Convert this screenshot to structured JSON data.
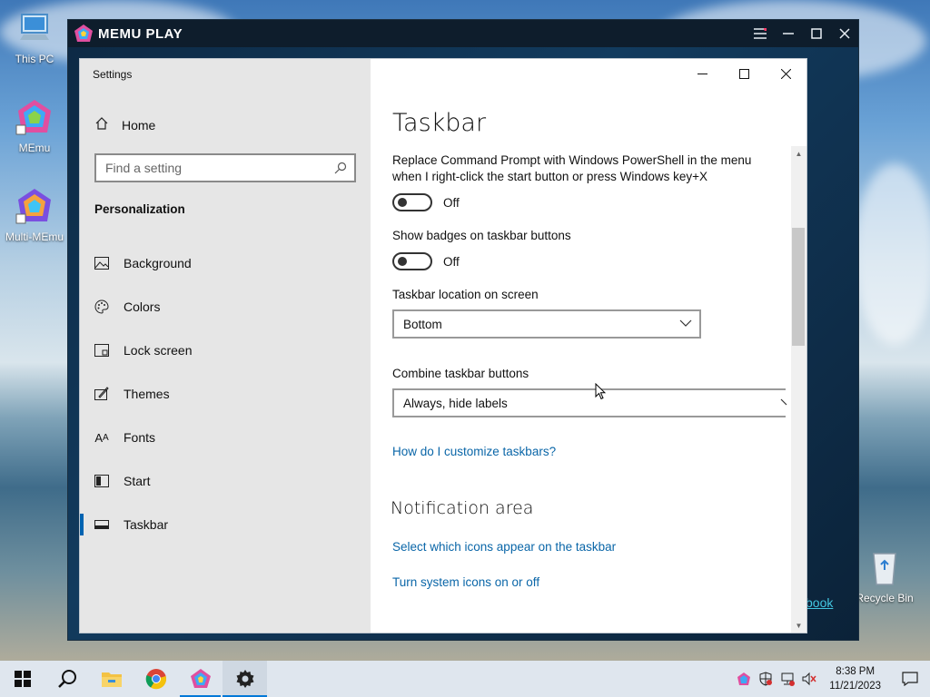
{
  "desktop": {
    "icons": [
      {
        "label": "This PC"
      },
      {
        "label": "MEmu"
      },
      {
        "label": "Multi-MEmu"
      },
      {
        "label": "Recycle Bin"
      }
    ],
    "partial_link_text": "book"
  },
  "memu": {
    "title": "MEMU PLAY",
    "controls": [
      "menu-icon",
      "minimize-icon",
      "maximize-icon",
      "close-icon"
    ]
  },
  "settings": {
    "window_title": "Settings",
    "home_label": "Home",
    "search_placeholder": "Find a setting",
    "section_heading": "Personalization",
    "nav": [
      {
        "label": "Background",
        "icon": "picture-icon"
      },
      {
        "label": "Colors",
        "icon": "palette-icon"
      },
      {
        "label": "Lock screen",
        "icon": "lock-screen-icon"
      },
      {
        "label": "Themes",
        "icon": "themes-icon"
      },
      {
        "label": "Fonts",
        "icon": "fonts-icon"
      },
      {
        "label": "Start",
        "icon": "start-icon"
      },
      {
        "label": "Taskbar",
        "icon": "taskbar-icon",
        "active": true
      }
    ],
    "page_title": "Taskbar",
    "powershell_text_line1": "Replace Command Prompt with Windows PowerShell in the menu",
    "powershell_text_line2": "when I right-click the start button or press Windows key+X",
    "powershell_state": "Off",
    "badges_label": "Show badges on taskbar buttons",
    "badges_state": "Off",
    "location_label": "Taskbar location on screen",
    "location_value": "Bottom",
    "combine_label": "Combine taskbar buttons",
    "combine_value": "Always, hide labels",
    "customize_link": "How do I customize taskbars?",
    "notification_heading": "Notification area",
    "notif_link1": "Select which icons appear on the taskbar",
    "notif_link2": "Turn system icons on or off"
  },
  "taskbar": {
    "apps": [
      "start-icon",
      "search-icon",
      "file-explorer-icon",
      "chrome-icon",
      "memu-icon",
      "settings-icon"
    ],
    "time": "8:38 PM",
    "date": "11/21/2023"
  },
  "colors": {
    "accent": "#0063b1",
    "link": "#0a66a8",
    "sidebar_bg": "#e6e6e6"
  }
}
